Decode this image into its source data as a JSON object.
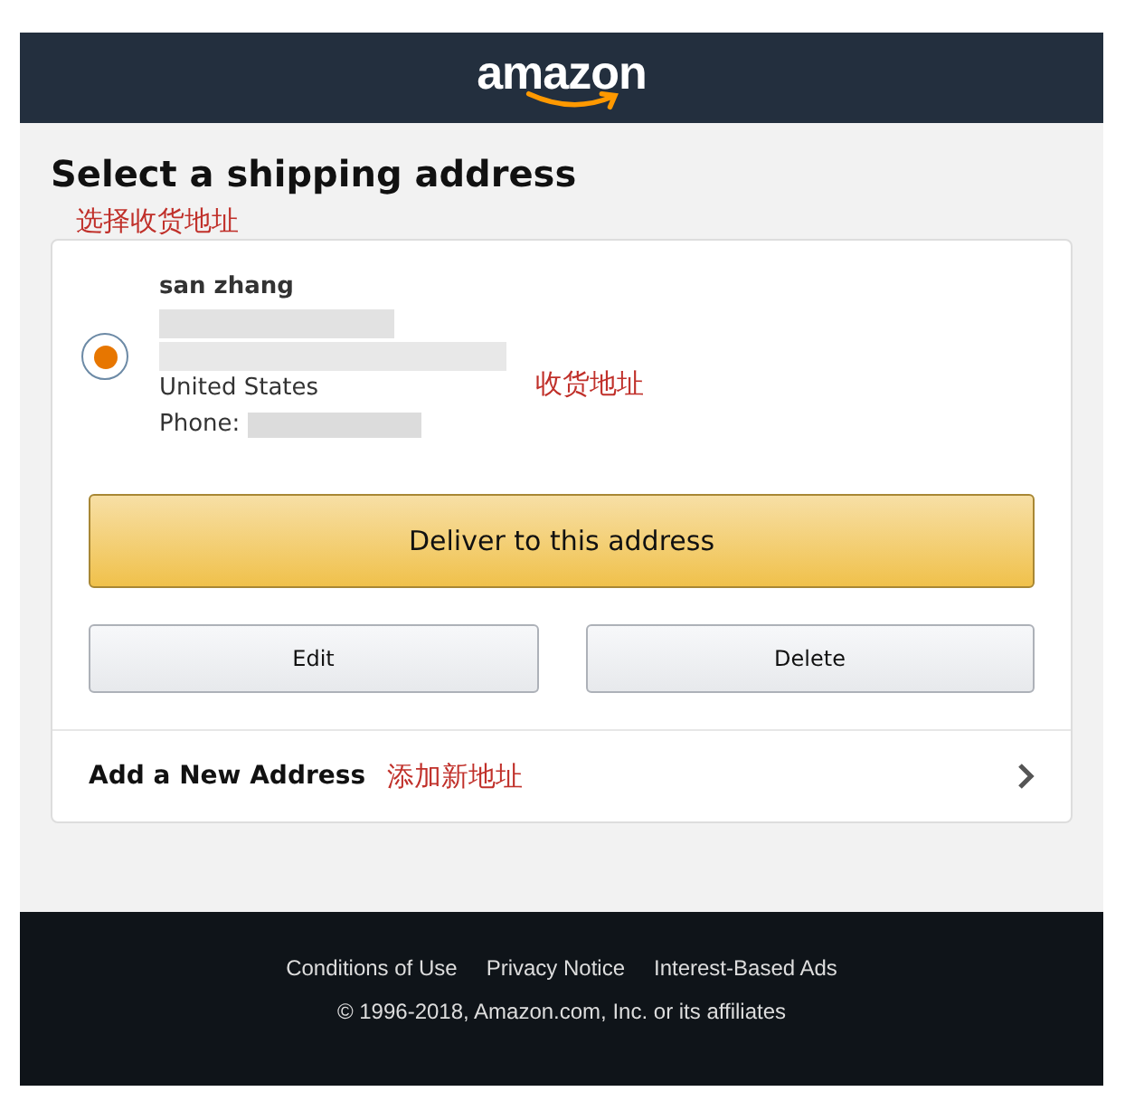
{
  "header": {
    "logo": "amazon"
  },
  "title": "Select a shipping address",
  "annotations": {
    "title_note": "选择收货地址",
    "address_note": "收货地址",
    "add_note": "添加新地址"
  },
  "addresses": [
    {
      "name": "san zhang",
      "country": "United States",
      "phone_label": "Phone:",
      "selected": true
    }
  ],
  "primary_button": "Deliver to this address",
  "secondary_buttons": [
    "Edit",
    "Delete"
  ],
  "add_address": "Add a New Address",
  "footer": {
    "links": [
      "Conditions of Use",
      "Privacy Notice",
      "Interest-Based Ads"
    ],
    "copyright": "© 1996-2018, Amazon.com, Inc. or its affiliates"
  }
}
